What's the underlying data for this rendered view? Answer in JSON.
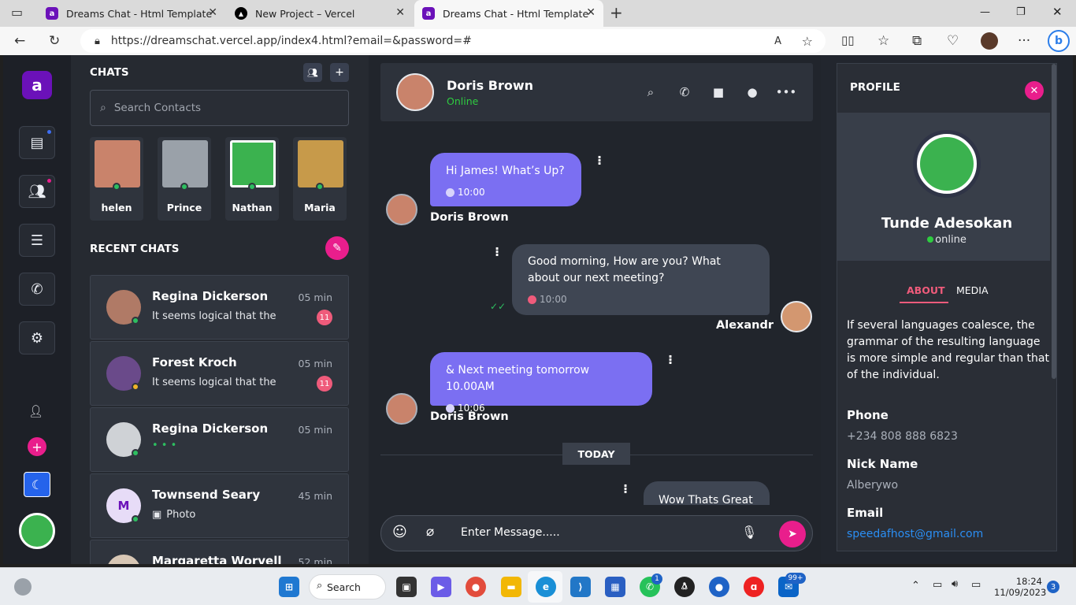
{
  "browser": {
    "tabs": [
      {
        "title": "Dreams Chat - Html Template"
      },
      {
        "title": "New Project – Vercel"
      },
      {
        "title": "Dreams Chat - Html Template"
      }
    ],
    "url": "https://dreamschat.vercel.app/index4.html?email=&password=#"
  },
  "sidebar": {
    "logo_letter": "a"
  },
  "chats": {
    "title": "CHATS",
    "search_placeholder": "Search Contacts",
    "stories": [
      {
        "name": "helen",
        "color": "#c9836b"
      },
      {
        "name": "Prince",
        "color": "#9aa1a9"
      },
      {
        "name": "Nathan",
        "color": "#3bb24f"
      },
      {
        "name": "Maria",
        "color": "#c79a4a"
      }
    ],
    "recent_title": "RECENT CHATS",
    "items": [
      {
        "name": "Regina Dickerson",
        "message": "It seems logical that the",
        "time": "05 min",
        "badge": "11",
        "status_color": "#2dbe60",
        "avatar_color": "#b07a66"
      },
      {
        "name": "Forest Kroch",
        "message": "It seems logical that the",
        "time": "05 min",
        "badge": "11",
        "status_color": "#f0b429",
        "avatar_color": "#6a4a8a"
      },
      {
        "name": "Regina Dickerson",
        "message": "",
        "time": "05 min",
        "badge": "",
        "status_color": "#2dbe60",
        "avatar_color": "#cfd2d6"
      },
      {
        "name": "Townsend Seary",
        "message": "Photo",
        "time": "45 min",
        "badge": "",
        "status_color": "#2dbe60",
        "avatar_letter": "M",
        "avatar_color": "#e7dcf7"
      },
      {
        "name": "Margaretta Worvell",
        "message": "",
        "time": "52 min",
        "badge": "",
        "status_color": "#2dbe60",
        "avatar_color": "#d8c7b5"
      }
    ]
  },
  "conversation": {
    "contact_name": "Doris Brown",
    "contact_status": "Online",
    "messages": [
      {
        "text": "Hi James! What’s Up?",
        "time": "10:00",
        "sender": "Doris Brown",
        "direction": "in"
      },
      {
        "text": "Good morning, How are you? What about our next meeting?",
        "time": "10:00",
        "sender": "Alexandr",
        "direction": "out"
      },
      {
        "text": "& Next meeting tomorrow 10.00AM",
        "time": "10:06",
        "sender": "Doris Brown",
        "direction": "in"
      },
      {
        "text": "Wow Thats Great",
        "direction": "out"
      }
    ],
    "divider": "TODAY",
    "input_placeholder": "Enter Message....."
  },
  "profile": {
    "title": "PROFILE",
    "name": "Tunde Adesokan",
    "status": "online",
    "tabs": [
      "ABOUT",
      "MEDIA"
    ],
    "active_tab": "ABOUT",
    "about": "If several languages coalesce, the grammar of the resulting language is more simple and regular than that of the individual.",
    "phone_label": "Phone",
    "phone": "+234 808 888 6823",
    "nick_label": "Nick Name",
    "nick": "Alberywo",
    "email_label": "Email",
    "email": "speedafhost@gmail.com"
  },
  "taskbar": {
    "search_label": "Search",
    "time": "18:24",
    "date": "11/09/2023",
    "whatsapp_badge": "1",
    "mail_badge": "99+",
    "notification_count": "3"
  },
  "colors": {
    "accent_purple": "#7b6ff2",
    "accent_pink": "#e91e8c",
    "online_green": "#2ecc40"
  }
}
